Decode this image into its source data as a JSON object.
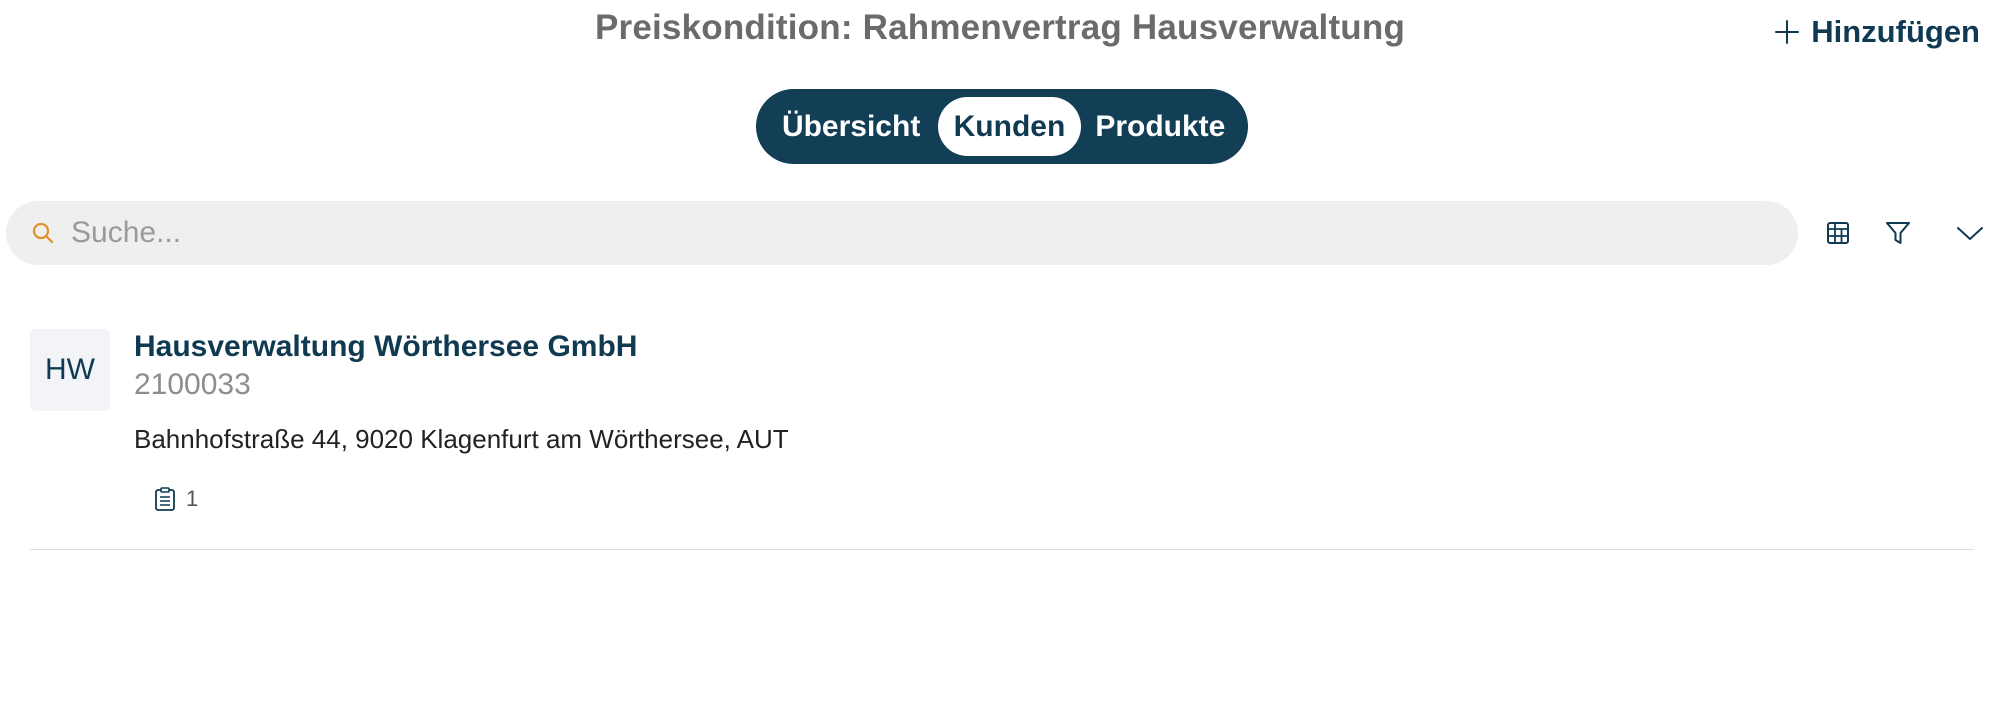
{
  "header": {
    "title": "Preiskondition: Rahmenvertrag Hausverwaltung",
    "add_label": "Hinzufügen",
    "add_icon": "plus-icon"
  },
  "tabs": [
    {
      "label": "Übersicht",
      "active": false
    },
    {
      "label": "Kunden",
      "active": true
    },
    {
      "label": "Produkte",
      "active": false
    }
  ],
  "search": {
    "placeholder": "Suche...",
    "value": "",
    "icon": "search-icon"
  },
  "toolbar": {
    "icons": [
      "table-icon",
      "filter-icon",
      "chevron-down-icon"
    ]
  },
  "customers": [
    {
      "initials": "HW",
      "name": "Hausverwaltung Wörthersee GmbH",
      "number": "2100033",
      "address": "Bahnhofstraße 44, 9020 Klagenfurt am Wörthersee, AUT",
      "attachment_count": "1",
      "attachment_icon": "clipboard-icon"
    }
  ],
  "colors": {
    "primary": "#123e56",
    "search_icon": "#e0902a",
    "title_gray": "#6b6b6b",
    "search_bg": "#efefef"
  }
}
